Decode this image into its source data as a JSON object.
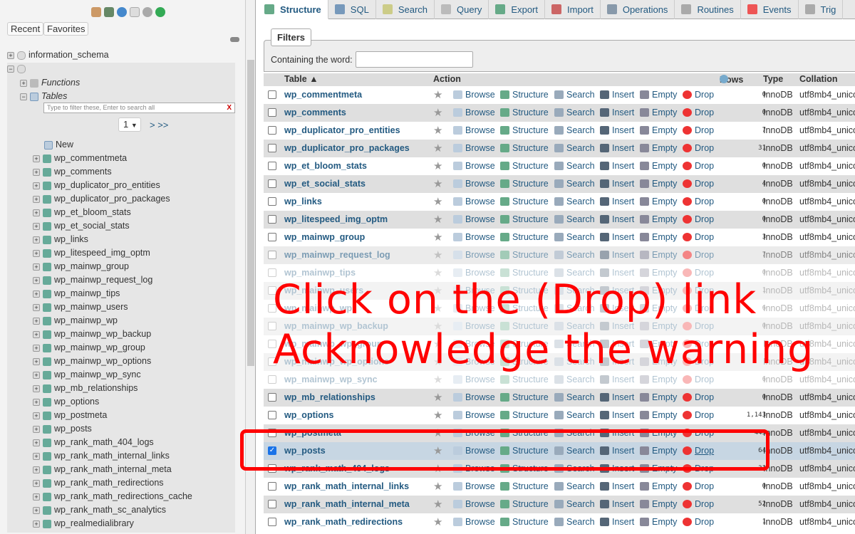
{
  "sidebar": {
    "recent": "Recent",
    "favorites": "Favorites",
    "db1": "information_schema",
    "functions": "Functions",
    "tables": "Tables",
    "filter_placeholder": "Type to filter these, Enter to search all",
    "filter_clear": "X",
    "page": "1",
    "page_next": "> >>",
    "new": "New",
    "items": [
      "wp_commentmeta",
      "wp_comments",
      "wp_duplicator_pro_entities",
      "wp_duplicator_pro_packages",
      "wp_et_bloom_stats",
      "wp_et_social_stats",
      "wp_links",
      "wp_litespeed_img_optm",
      "wp_mainwp_group",
      "wp_mainwp_request_log",
      "wp_mainwp_tips",
      "wp_mainwp_users",
      "wp_mainwp_wp",
      "wp_mainwp_wp_backup",
      "wp_mainwp_wp_group",
      "wp_mainwp_wp_options",
      "wp_mainwp_wp_sync",
      "wp_mb_relationships",
      "wp_options",
      "wp_postmeta",
      "wp_posts",
      "wp_rank_math_404_logs",
      "wp_rank_math_internal_links",
      "wp_rank_math_internal_meta",
      "wp_rank_math_redirections",
      "wp_rank_math_redirections_cache",
      "wp_rank_math_sc_analytics",
      "wp_realmedialibrary"
    ]
  },
  "tabs": [
    "Structure",
    "SQL",
    "Search",
    "Query",
    "Export",
    "Import",
    "Operations",
    "Routines",
    "Events",
    "Trig"
  ],
  "filters": {
    "legend": "Filters",
    "label": "Containing the word:",
    "value": ""
  },
  "table": {
    "headers": {
      "table": "Table ▲",
      "action": "Action",
      "rows": "Rows",
      "type": "Type",
      "collation": "Collation"
    },
    "actions": [
      "Browse",
      "Structure",
      "Search",
      "Insert",
      "Empty",
      "Drop"
    ],
    "rows": [
      {
        "name": "wp_commentmeta",
        "rows": "0",
        "type": "InnoDB",
        "collation": "utf8mb4_unico"
      },
      {
        "name": "wp_comments",
        "rows": "0",
        "type": "InnoDB",
        "collation": "utf8mb4_unico"
      },
      {
        "name": "wp_duplicator_pro_entities",
        "rows": "7",
        "type": "InnoDB",
        "collation": "utf8mb4_unico"
      },
      {
        "name": "wp_duplicator_pro_packages",
        "rows": "31",
        "type": "InnoDB",
        "collation": "utf8mb4_unico"
      },
      {
        "name": "wp_et_bloom_stats",
        "rows": "0",
        "type": "InnoDB",
        "collation": "utf8mb4_unico"
      },
      {
        "name": "wp_et_social_stats",
        "rows": "4",
        "type": "InnoDB",
        "collation": "utf8mb4_unico"
      },
      {
        "name": "wp_links",
        "rows": "0",
        "type": "InnoDB",
        "collation": "utf8mb4_unico"
      },
      {
        "name": "wp_litespeed_img_optm",
        "rows": "0",
        "type": "InnoDB",
        "collation": "utf8mb4_unico"
      },
      {
        "name": "wp_mainwp_group",
        "rows": "3",
        "type": "InnoDB",
        "collation": "utf8mb4_unico"
      },
      {
        "name": "wp_mainwp_request_log",
        "rows": "7",
        "type": "InnoDB",
        "collation": "utf8mb4_unico"
      },
      {
        "name": "wp_mainwp_tips",
        "rows": "0",
        "type": "InnoDB",
        "collation": "utf8mb4_unico"
      },
      {
        "name": "wp_mainwp_users",
        "rows": "1",
        "type": "InnoDB",
        "collation": "utf8mb4_unico"
      },
      {
        "name": "wp_mainwp_wp",
        "rows": "6",
        "type": "InnoDB",
        "collation": "utf8mb4_unico"
      },
      {
        "name": "wp_mainwp_wp_backup",
        "rows": "0",
        "type": "InnoDB",
        "collation": "utf8mb4_unico"
      },
      {
        "name": "wp_mainwp_wp_group",
        "rows": "",
        "type": "InnoDB",
        "collation": "utf8mb4_unico"
      },
      {
        "name": "wp_mainwp_wp_options",
        "rows": "",
        "type": "InnoDB",
        "collation": "utf8mb4_unico"
      },
      {
        "name": "wp_mainwp_wp_sync",
        "rows": "6",
        "type": "InnoDB",
        "collation": "utf8mb4_unico"
      },
      {
        "name": "wp_mb_relationships",
        "rows": "0",
        "type": "InnoDB",
        "collation": "utf8mb4_unico"
      },
      {
        "name": "wp_options",
        "rows": "1,143",
        "type": "InnoDB",
        "collation": "utf8mb4_unico"
      },
      {
        "name": "wp_postmeta",
        "rows": "445",
        "type": "InnoDB",
        "collation": "utf8mb4_unico"
      },
      {
        "name": "wp_posts",
        "rows": "64",
        "type": "InnoDB",
        "collation": "utf8mb4_unico",
        "checked": true
      },
      {
        "name": "wp_rank_math_404_logs",
        "rows": "31",
        "type": "InnoDB",
        "collation": "utf8mb4_unico"
      },
      {
        "name": "wp_rank_math_internal_links",
        "rows": "0",
        "type": "InnoDB",
        "collation": "utf8mb4_unico"
      },
      {
        "name": "wp_rank_math_internal_meta",
        "rows": "52",
        "type": "InnoDB",
        "collation": "utf8mb4_unico"
      },
      {
        "name": "wp_rank_math_redirections",
        "rows": "1",
        "type": "InnoDB",
        "collation": "utf8mb4_unico"
      }
    ]
  },
  "overlay": {
    "line1": "Click on the (Drop) link",
    "line2": "Acknowledge the warning",
    "color": "#ff0000"
  }
}
